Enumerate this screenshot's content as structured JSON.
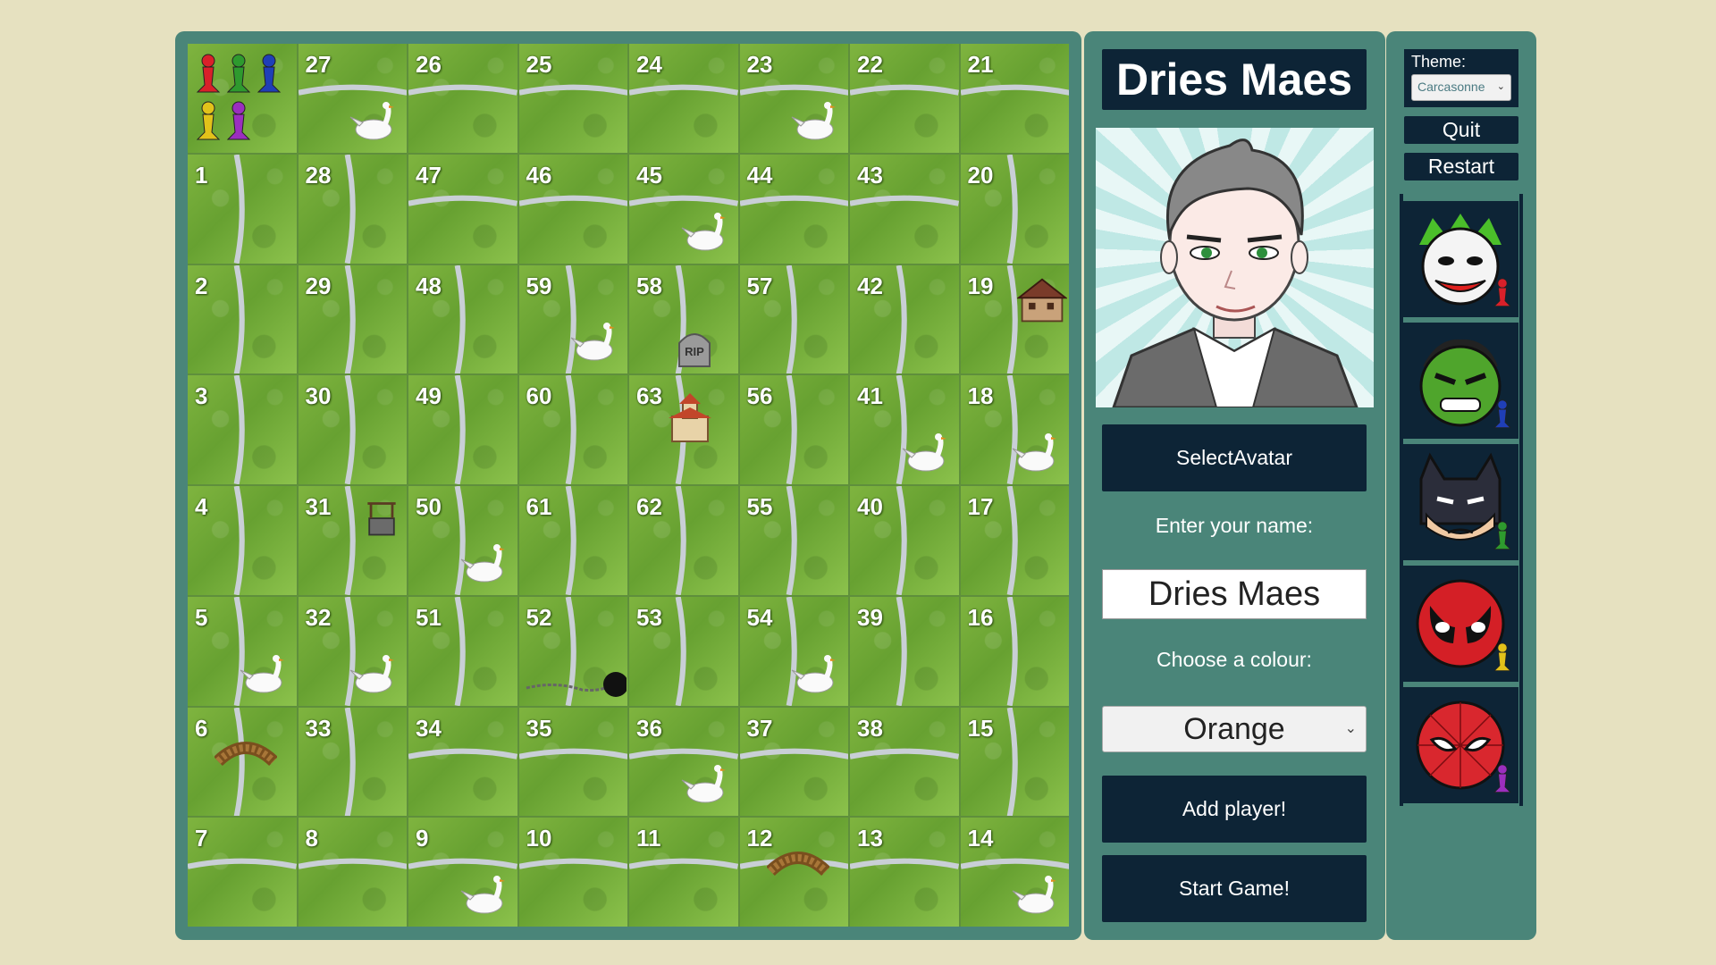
{
  "board": {
    "rows": [
      [
        "",
        "27",
        "26",
        "25",
        "24",
        "23",
        "22",
        "21"
      ],
      [
        "1",
        "28",
        "47",
        "46",
        "45",
        "44",
        "43",
        "20"
      ],
      [
        "2",
        "29",
        "48",
        "59",
        "58",
        "57",
        "42",
        "19"
      ],
      [
        "3",
        "30",
        "49",
        "60",
        "63",
        "56",
        "41",
        "18"
      ],
      [
        "4",
        "31",
        "50",
        "61",
        "62",
        "55",
        "40",
        "17"
      ],
      [
        "5",
        "32",
        "51",
        "52",
        "53",
        "54",
        "39",
        "16"
      ],
      [
        "6",
        "33",
        "34",
        "35",
        "36",
        "37",
        "38",
        "15"
      ],
      [
        "7",
        "8",
        "9",
        "10",
        "11",
        "12",
        "13",
        "14"
      ]
    ],
    "tombstone_text": "RIP",
    "pawn_colors": [
      "#d9202a",
      "#2e9a2e",
      "#1f3fb7",
      "#e2c21a",
      "#9b2fbf"
    ]
  },
  "player_panel": {
    "name_title": "Dries Maes",
    "select_avatar_label": "SelectAvatar",
    "name_label": "Enter your name:",
    "name_value": "Dries Maes",
    "colour_label": "Choose a colour:",
    "colour_value": "Orange",
    "add_player_label": "Add player!",
    "start_game_label": "Start Game!"
  },
  "side_panel": {
    "theme_label": "Theme:",
    "theme_value": "Carcasonne",
    "quit_label": "Quit",
    "restart_label": "Restart",
    "avatars": [
      {
        "name": "joker",
        "pawn": "#d9202a"
      },
      {
        "name": "hulk",
        "pawn": "#1f3fb7"
      },
      {
        "name": "batman",
        "pawn": "#2e9a2e"
      },
      {
        "name": "deadpool",
        "pawn": "#e2c21a"
      },
      {
        "name": "spiderman",
        "pawn": "#9b2fbf"
      }
    ]
  },
  "icons": {
    "dropdown": "chevron-down-icon"
  }
}
